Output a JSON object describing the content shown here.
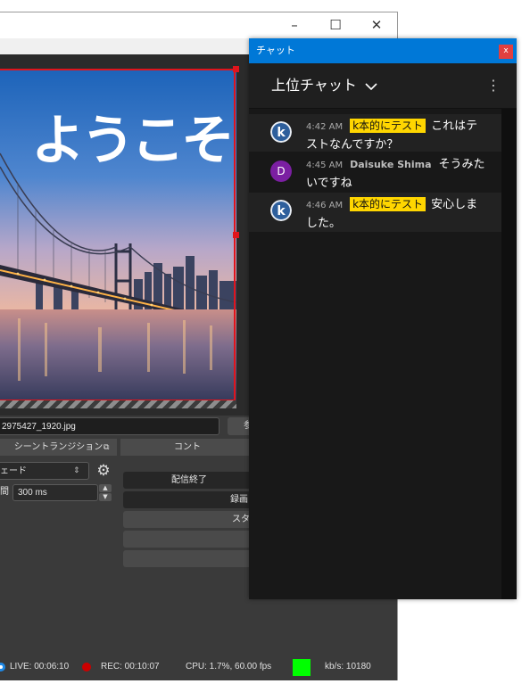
{
  "obs": {
    "welcome_text": "ようこそ",
    "file_path": "2975427_1920.jpg",
    "file_button": "参",
    "transitions_header": "シーントランジション",
    "transition_value": "ェード",
    "duration_label": "間",
    "duration_value": "300 ms",
    "controls_header": "コント",
    "controls": [
      "配信終了",
      "録画",
      "スタ",
      "",
      ""
    ],
    "status": {
      "live": "LIVE: 00:06:10",
      "rec": "REC: 00:10:07",
      "cpu": "CPU: 1.7%, 60.00 fps",
      "kbs": "kb/s: 10180"
    },
    "colors": {
      "selection": "#e0141c",
      "live_indicator": "#00ff00",
      "rec_dot": "#cc0000"
    }
  },
  "chat": {
    "window_title": "チャット",
    "close_label": "x",
    "mode_label": "上位チャット",
    "messages": [
      {
        "time": "4:42 AM",
        "author": "k本的にテスト",
        "text": "これはテストなんですか？",
        "avatar": "k-logo-icon"
      },
      {
        "time": "4:45 AM",
        "author": "Daisuke Shima",
        "text": "そうみたいですね",
        "avatar_letter": "D"
      },
      {
        "time": "4:46 AM",
        "author": "k本的にテスト",
        "text": "安心しました。",
        "avatar": "k-logo-icon"
      }
    ],
    "colors": {
      "titlebar": "#0078d7",
      "badge": "#ffd600",
      "avatar_d": "#7b1fa2"
    }
  }
}
